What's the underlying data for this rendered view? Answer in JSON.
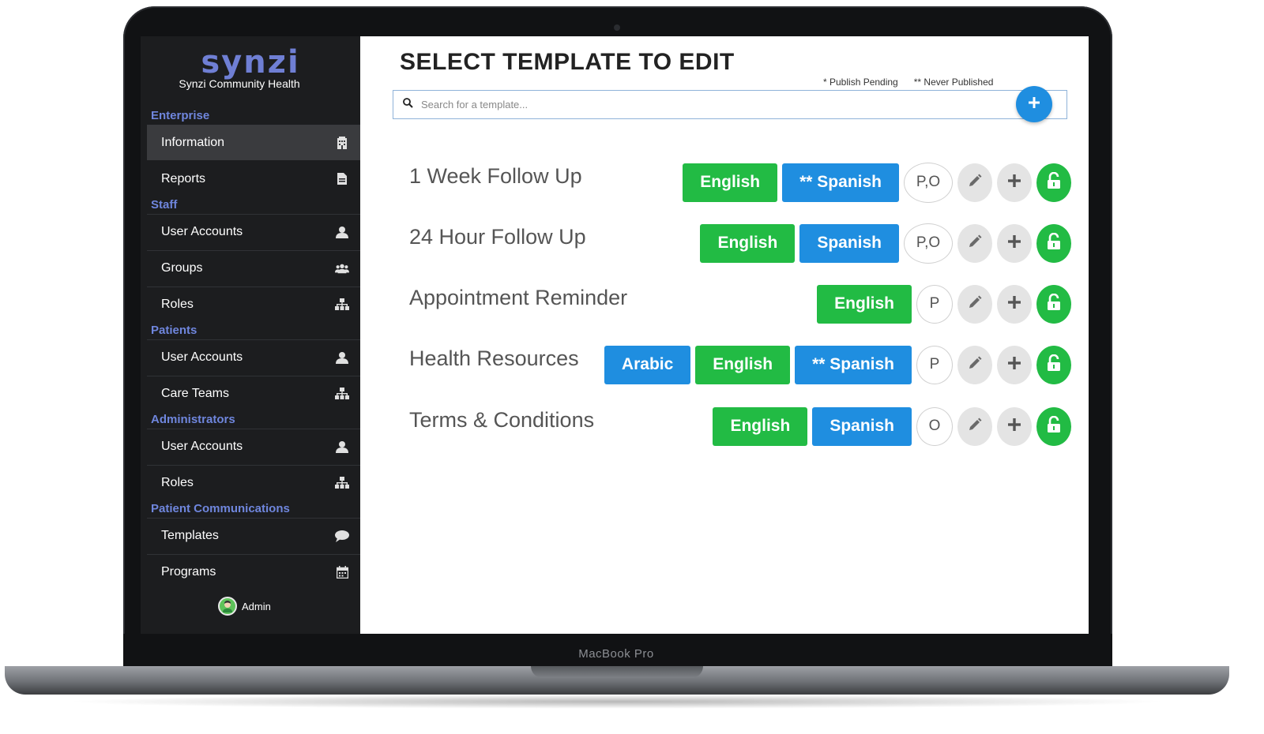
{
  "device": {
    "label": "MacBook Pro"
  },
  "sidebar": {
    "logo": "synzi",
    "org_name": "Synzi Community Health",
    "sections": {
      "enterprise": "Enterprise",
      "staff": "Staff",
      "patients": "Patients",
      "administrators": "Administrators",
      "patient_communications": "Patient Communications"
    },
    "items": [
      {
        "label": "Information",
        "icon": "building-icon"
      },
      {
        "label": "Reports",
        "icon": "document-icon"
      },
      {
        "label": "User Accounts",
        "icon": "user-icon"
      },
      {
        "label": "Groups",
        "icon": "users-icon"
      },
      {
        "label": "Roles",
        "icon": "hierarchy-icon"
      },
      {
        "label": "User Accounts",
        "icon": "user-icon"
      },
      {
        "label": "Care Teams",
        "icon": "hierarchy-icon"
      },
      {
        "label": "User Accounts",
        "icon": "user-icon"
      },
      {
        "label": "Roles",
        "icon": "hierarchy-icon"
      },
      {
        "label": "Templates",
        "icon": "chat-bubble-icon"
      },
      {
        "label": "Programs",
        "icon": "calendar-icon"
      }
    ],
    "admin": "Admin"
  },
  "main": {
    "title": "SELECT TEMPLATE TO EDIT",
    "legend": {
      "publish_pending": "* Publish Pending",
      "never_published": "** Never Published"
    },
    "search": {
      "placeholder": "Search for a template..."
    },
    "templates": [
      {
        "name": "1 Week Follow Up",
        "status": "P,O",
        "langs": [
          {
            "label": "English",
            "color": "green"
          },
          {
            "label": "** Spanish",
            "color": "blue"
          }
        ]
      },
      {
        "name": "24 Hour Follow Up",
        "status": "P,O",
        "langs": [
          {
            "label": "English",
            "color": "green"
          },
          {
            "label": "Spanish",
            "color": "blue"
          }
        ]
      },
      {
        "name": "Appointment Reminder",
        "status": "P",
        "langs": [
          {
            "label": "English",
            "color": "green"
          }
        ]
      },
      {
        "name": "Health Resources",
        "status": "P",
        "langs": [
          {
            "label": "Arabic",
            "color": "blue"
          },
          {
            "label": "English",
            "color": "green"
          },
          {
            "label": "** Spanish",
            "color": "blue"
          }
        ]
      },
      {
        "name": "Terms & Conditions",
        "status": "O",
        "langs": [
          {
            "label": "English",
            "color": "green"
          },
          {
            "label": "Spanish",
            "color": "blue"
          }
        ]
      }
    ]
  },
  "colors": {
    "accent_blue": "#1f8ee0",
    "accent_green": "#22bb44",
    "sidebar_bg": "#1c1d1f",
    "section_title": "#6f86dd"
  }
}
